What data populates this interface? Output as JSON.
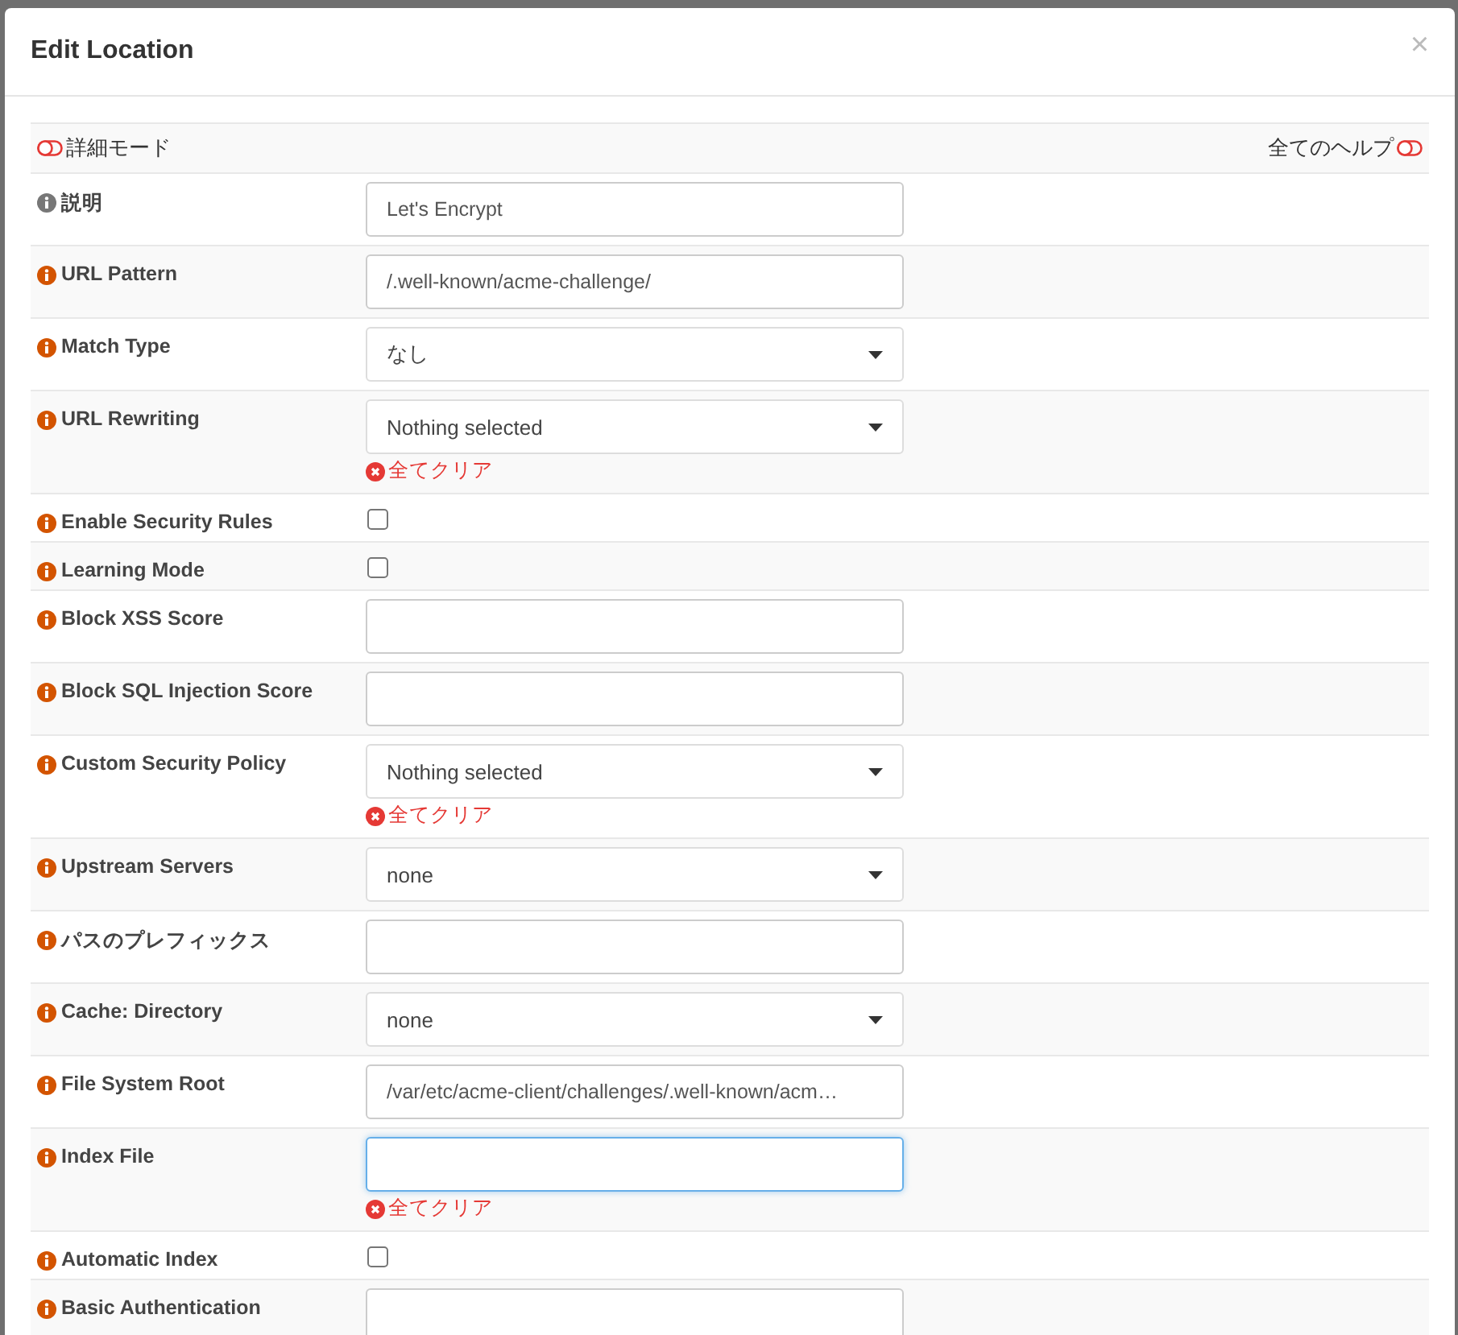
{
  "dialog": {
    "title": "Edit Location",
    "close": "×"
  },
  "toolbar": {
    "advanced_mode": {
      "label": "詳細モード",
      "on": false
    },
    "full_help": {
      "label": "全てのヘルプ",
      "on": false
    }
  },
  "fields": [
    {
      "label": "説明",
      "kind": "text",
      "value": "Let's Encrypt",
      "help": false
    },
    {
      "label": "URL Pattern",
      "kind": "text",
      "value": "/.well-known/acme-challenge/",
      "help": true
    },
    {
      "label": "Match Type",
      "kind": "select",
      "value": "なし",
      "help": true
    },
    {
      "label": "URL Rewriting",
      "kind": "select",
      "value": "Nothing selected",
      "help": true,
      "clear": "全てクリア"
    },
    {
      "label": "Enable Security Rules",
      "kind": "checkbox",
      "checked": false,
      "help": true
    },
    {
      "label": "Learning Mode",
      "kind": "checkbox",
      "checked": false,
      "help": true
    },
    {
      "label": "Block XSS Score",
      "kind": "text",
      "help": true
    },
    {
      "label": "Block SQL Injection Score",
      "kind": "text",
      "help": true
    },
    {
      "label": "Custom Security Policy",
      "kind": "select",
      "value": "Nothing selected",
      "help": true,
      "clear": "全てクリア"
    },
    {
      "label": "Upstream Servers",
      "kind": "select",
      "value": "none",
      "help": true
    },
    {
      "label": "パスのプレフィックス",
      "kind": "text",
      "help": true
    },
    {
      "label": "Cache: Directory",
      "kind": "select",
      "value": "none",
      "help": true
    },
    {
      "label": "File System Root",
      "kind": "text",
      "value": "/var/etc/acme-client/challenges/.well-known/acm…",
      "help": true
    },
    {
      "label": "Index File",
      "kind": "text",
      "help": true,
      "focused": true,
      "clear": "全てクリア"
    },
    {
      "label": "Automatic Index",
      "kind": "checkbox",
      "checked": false,
      "help": true
    },
    {
      "label": "Basic Authentication",
      "kind": "text",
      "help": true
    }
  ]
}
